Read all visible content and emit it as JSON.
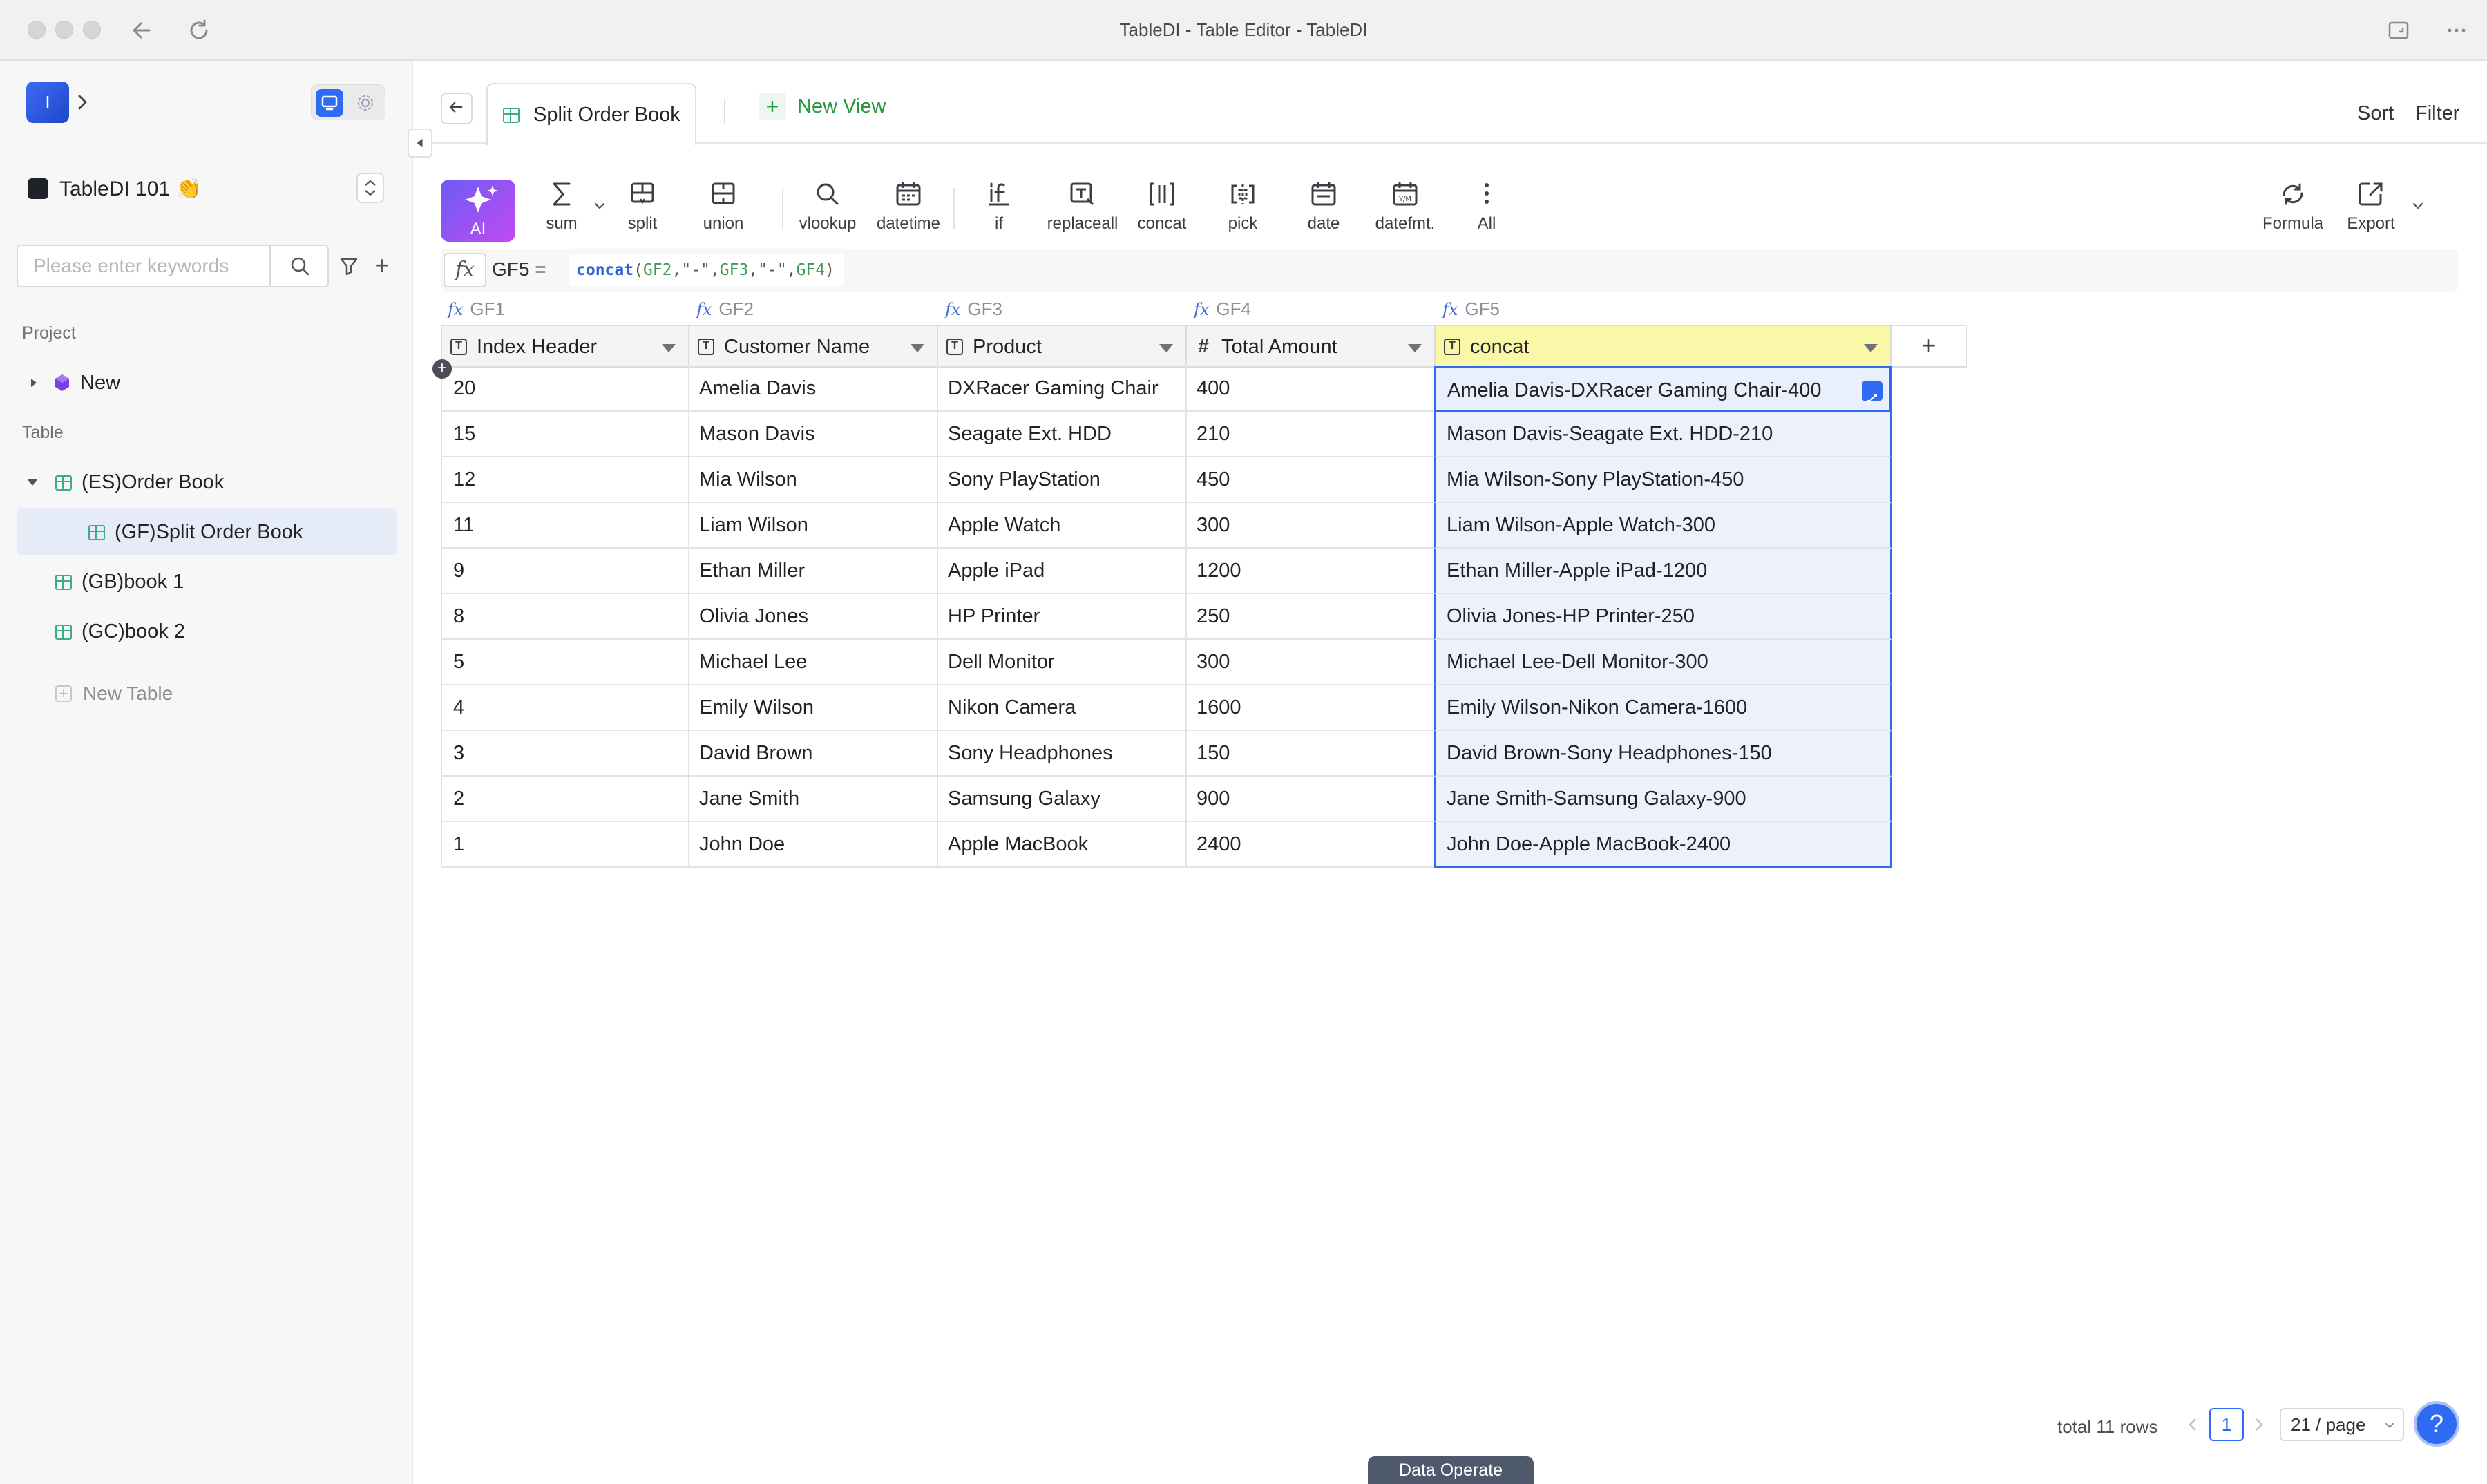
{
  "window": {
    "title": "TableDI - Table Editor - TableDI"
  },
  "sidebar": {
    "logo_letter": "I",
    "project_name": "TableDI 101 👏",
    "search": {
      "placeholder": "Please enter keywords",
      "value": ""
    },
    "sections": {
      "project": "Project",
      "table": "Table"
    },
    "project_items": [
      {
        "label": "New",
        "icon": "cube-icon",
        "icon_color": "#7b3fe4"
      }
    ],
    "tables": [
      {
        "label": "(ES)Order Book",
        "expanded": true
      },
      {
        "label": "(GF)Split Order Book",
        "selected": true
      },
      {
        "label": "(GB)book 1"
      },
      {
        "label": "(GC)book 2"
      }
    ],
    "new_table": "New Table"
  },
  "tabbar": {
    "active_tab": "Split Order Book",
    "new_view": "New View",
    "sort": "Sort",
    "filter": "Filter"
  },
  "toolbar": {
    "ai": "AI",
    "tools": [
      {
        "label": "sum",
        "icon": "sigma-icon"
      },
      {
        "label": "split",
        "icon": "split-icon"
      },
      {
        "label": "union",
        "icon": "union-icon"
      },
      {
        "label": "vlookup",
        "icon": "search-icon"
      },
      {
        "label": "datetime",
        "icon": "calendar-icon"
      },
      {
        "label": "if",
        "icon": "if-icon"
      },
      {
        "label": "replaceall",
        "icon": "replace-icon"
      },
      {
        "label": "concat",
        "icon": "concat-icon"
      },
      {
        "label": "pick",
        "icon": "pick-icon"
      },
      {
        "label": "date",
        "icon": "calendar-icon"
      },
      {
        "label": "datefmt.",
        "icon": "calendar-format-icon"
      },
      {
        "label": "All",
        "icon": "more-vertical-icon"
      }
    ],
    "right": [
      {
        "label": "Formula",
        "icon": "refresh-icon"
      },
      {
        "label": "Export",
        "icon": "export-icon"
      }
    ]
  },
  "formula_bar": {
    "cell_ref": "GF5 =",
    "fn": "concat",
    "parts": [
      "(",
      "GF2",
      ",\"-\",",
      "GF3",
      ",\"-\",",
      "GF4",
      ")"
    ]
  },
  "table": {
    "formula_labels": [
      "GF1",
      "GF2",
      "GF3",
      "GF4",
      "GF5"
    ],
    "columns": [
      {
        "label": "Index Header",
        "type": "text"
      },
      {
        "label": "Customer Name",
        "type": "text"
      },
      {
        "label": "Product",
        "type": "text"
      },
      {
        "label": "Total Amount",
        "type": "number"
      },
      {
        "label": "concat",
        "type": "text",
        "highlighted": true
      }
    ],
    "rows": [
      [
        "20",
        "Amelia Davis",
        "DXRacer Gaming Chair",
        "400",
        "Amelia Davis-DXRacer Gaming Chair-400"
      ],
      [
        "15",
        "Mason Davis",
        "Seagate Ext. HDD",
        "210",
        "Mason Davis-Seagate Ext. HDD-210"
      ],
      [
        "12",
        "Mia Wilson",
        "Sony PlayStation",
        "450",
        "Mia Wilson-Sony PlayStation-450"
      ],
      [
        "11",
        "Liam Wilson",
        "Apple Watch",
        "300",
        "Liam Wilson-Apple Watch-300"
      ],
      [
        "9",
        "Ethan Miller",
        "Apple iPad",
        "1200",
        "Ethan Miller-Apple iPad-1200"
      ],
      [
        "8",
        "Olivia Jones",
        "HP Printer",
        "250",
        "Olivia Jones-HP Printer-250"
      ],
      [
        "5",
        "Michael Lee",
        "Dell Monitor",
        "300",
        "Michael Lee-Dell Monitor-300"
      ],
      [
        "4",
        "Emily Wilson",
        "Nikon Camera",
        "1600",
        "Emily Wilson-Nikon Camera-1600"
      ],
      [
        "3",
        "David Brown",
        "Sony Headphones",
        "150",
        "David Brown-Sony Headphones-150"
      ],
      [
        "2",
        "Jane Smith",
        "Samsung Galaxy",
        "900",
        "Jane Smith-Samsung Galaxy-900"
      ],
      [
        "1",
        "John Doe",
        "Apple MacBook",
        "2400",
        "John Doe-Apple MacBook-2400"
      ]
    ],
    "add_column": "+"
  },
  "footer": {
    "total_rows": "total 11 rows",
    "current_page": "1",
    "per_page": "21 / page",
    "help": "?",
    "data_operate": "Data Operate"
  },
  "colors": {
    "accent": "#2f6bf2",
    "highlight_header": "#fbf7a8",
    "table_icon": "#3dab8c",
    "new_view": "#27963c"
  }
}
